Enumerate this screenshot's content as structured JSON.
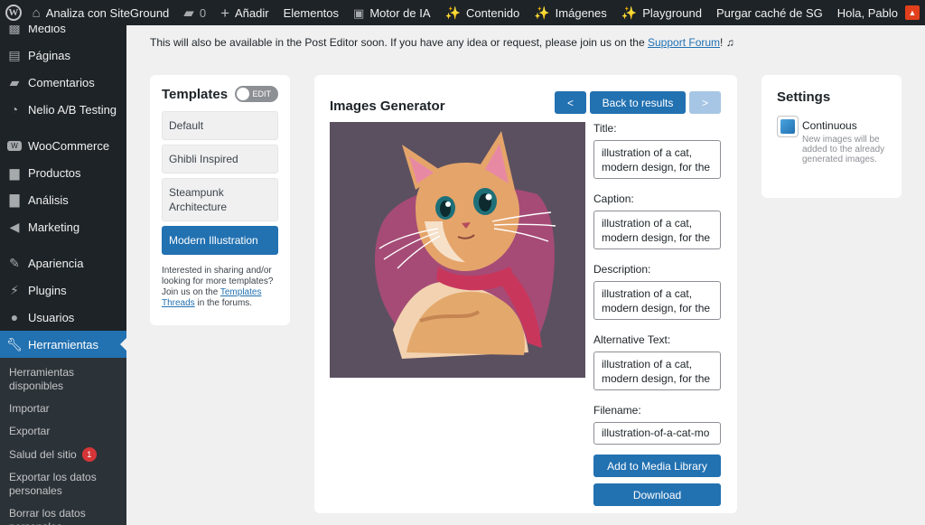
{
  "adminbar": {
    "site_name": "Analiza con SiteGround",
    "comments_count": "0",
    "add_new": "Añadir",
    "elementor": "Elementos",
    "ai_engine": "Motor de IA",
    "content": "Contenido",
    "images": "Imágenes",
    "playground": "Playground",
    "purge": "Purgar caché de SG",
    "greeting": "Hola, Pablo"
  },
  "sidebar": {
    "items": [
      {
        "label": "Medios",
        "icon": "media-icon"
      },
      {
        "label": "Páginas",
        "icon": "pages-icon"
      },
      {
        "label": "Comentarios",
        "icon": "comments-icon"
      },
      {
        "label": "Nelio A/B Testing",
        "icon": "nelio-icon"
      },
      {
        "label": "WooCommerce",
        "icon": "woocommerce-icon"
      },
      {
        "label": "Productos",
        "icon": "products-icon"
      },
      {
        "label": "Análisis",
        "icon": "analytics-icon"
      },
      {
        "label": "Marketing",
        "icon": "marketing-icon"
      },
      {
        "label": "Apariencia",
        "icon": "appearance-icon"
      },
      {
        "label": "Plugins",
        "icon": "plugins-icon"
      },
      {
        "label": "Usuarios",
        "icon": "users-icon"
      },
      {
        "label": "Herramientas",
        "icon": "tools-icon"
      }
    ],
    "submenu": [
      "Herramientas disponibles",
      "Importar",
      "Exportar",
      "Salud del sitio",
      "Exportar los datos personales",
      "Borrar los datos personales"
    ],
    "health_badge": "1"
  },
  "notice": {
    "text": "This will also be available in the Post Editor soon. If you have any idea or request, please join us on the ",
    "link": "Support Forum",
    "suffix": "! ♫"
  },
  "templates": {
    "title": "Templates",
    "toggle_label": "EDIT",
    "items": [
      "Default",
      "Ghibli Inspired",
      "Steampunk Architecture",
      "Modern Illustration"
    ],
    "active_index": 3,
    "footer_text": "Interested in sharing and/or looking for more templates? Join us on the ",
    "footer_link": "Templates Threads",
    "footer_suffix": " in the forums."
  },
  "generator": {
    "title": "Images Generator",
    "prev_label": "<",
    "back_label": "Back to results",
    "next_label": ">",
    "fields": {
      "title_label": "Title:",
      "title_value": "illustration of a cat, modern design, for the",
      "caption_label": "Caption:",
      "caption_value": "illustration of a cat, modern design, for the",
      "description_label": "Description:",
      "description_value": "illustration of a cat, modern design, for the",
      "alt_label": "Alternative Text:",
      "alt_value": "illustration of a cat, modern design, for the",
      "filename_label": "Filename:",
      "filename_value": "illustration-of-a-cat-mo"
    },
    "add_label": "Add to Media Library",
    "download_label": "Download"
  },
  "settings": {
    "title": "Settings",
    "continuous_label": "Continuous",
    "continuous_desc": "New images will be added to the already generated images."
  },
  "colors": {
    "accent": "#2271b1",
    "adminbar_bg": "#1d2327",
    "badge": "#d63638"
  }
}
